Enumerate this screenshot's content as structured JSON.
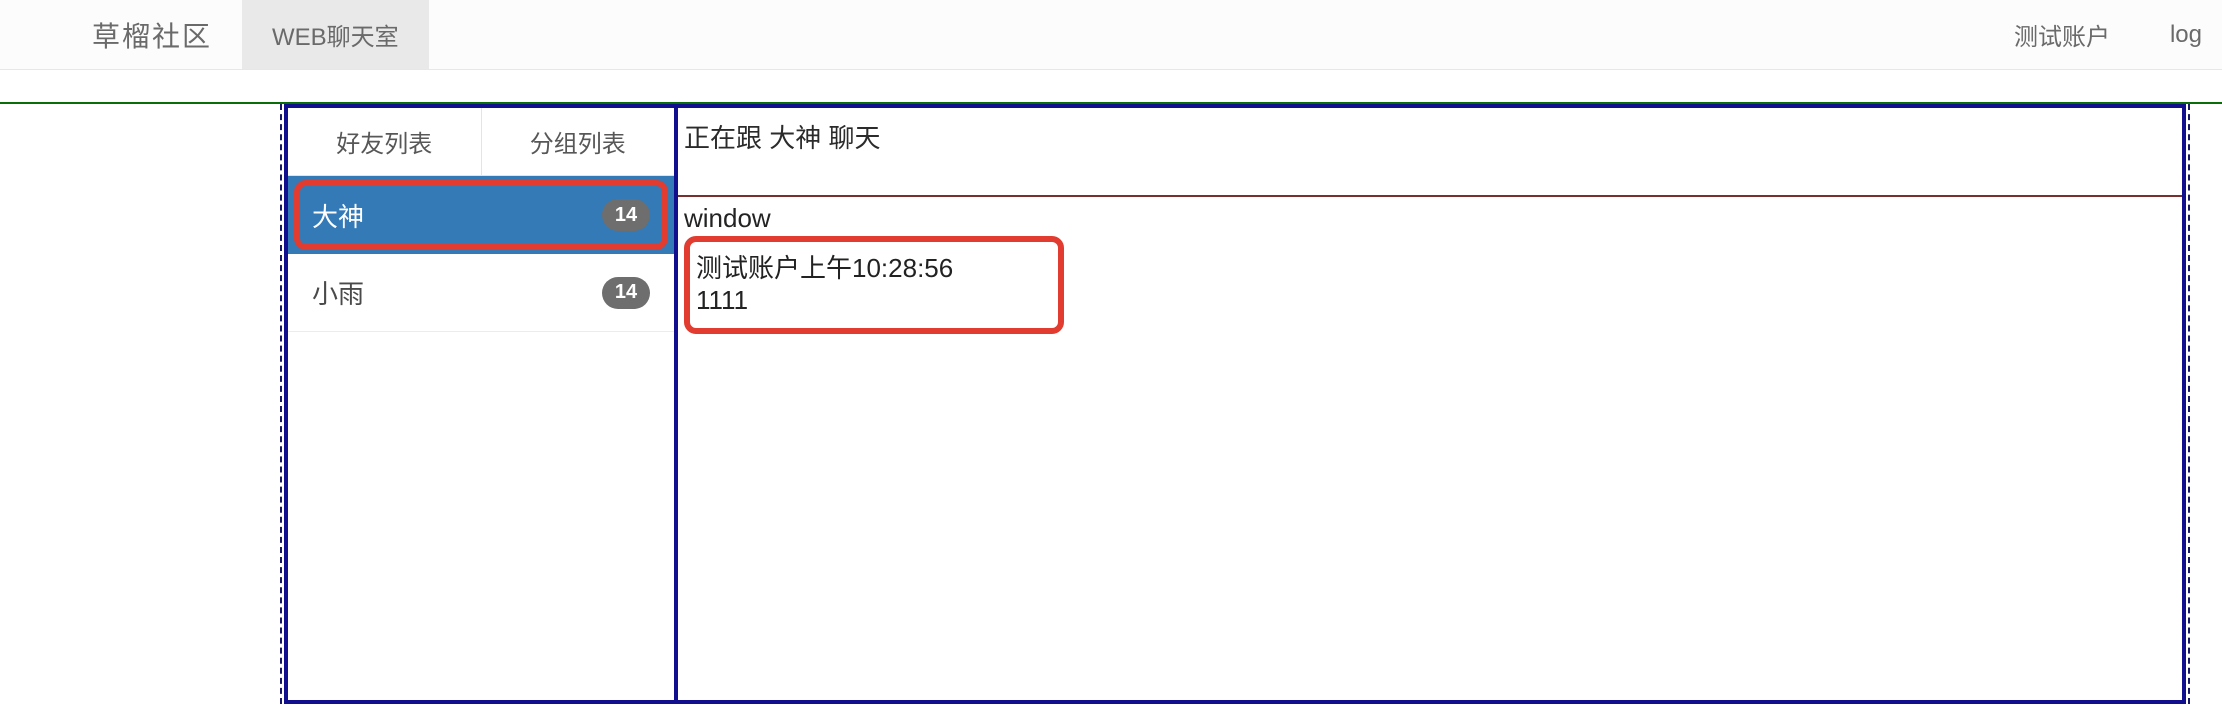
{
  "topbar": {
    "brand": "草榴社区",
    "active_tab": "WEB聊天室",
    "username": "测试账户",
    "logout": "log"
  },
  "sidebar": {
    "tabs": [
      {
        "label": "好友列表"
      },
      {
        "label": "分组列表"
      }
    ],
    "friends": [
      {
        "name": "大神",
        "badge": "14",
        "active": true
      },
      {
        "name": "小雨",
        "badge": "14",
        "active": false
      }
    ]
  },
  "chat": {
    "header": "正在跟 大神 聊天",
    "sys_line": "window",
    "message": {
      "meta": "测试账户上午10:28:56",
      "text": "1111"
    }
  }
}
